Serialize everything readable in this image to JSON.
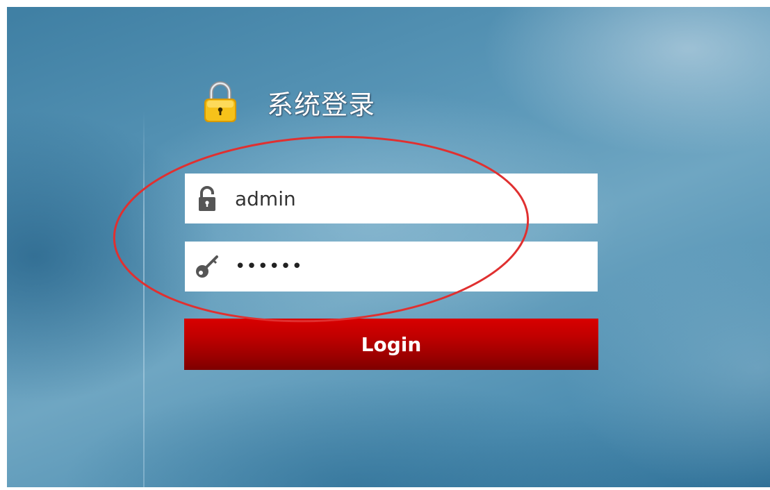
{
  "login": {
    "title": "系统登录",
    "username_value": "admin",
    "password_value": "••••••",
    "button_label": "Login"
  },
  "icons": {
    "title": "padlock-icon",
    "username": "lock-icon",
    "password": "key-icon"
  },
  "colors": {
    "button": "#c00000",
    "annotation": "#e03030",
    "padlock_body": "#f2b200"
  }
}
